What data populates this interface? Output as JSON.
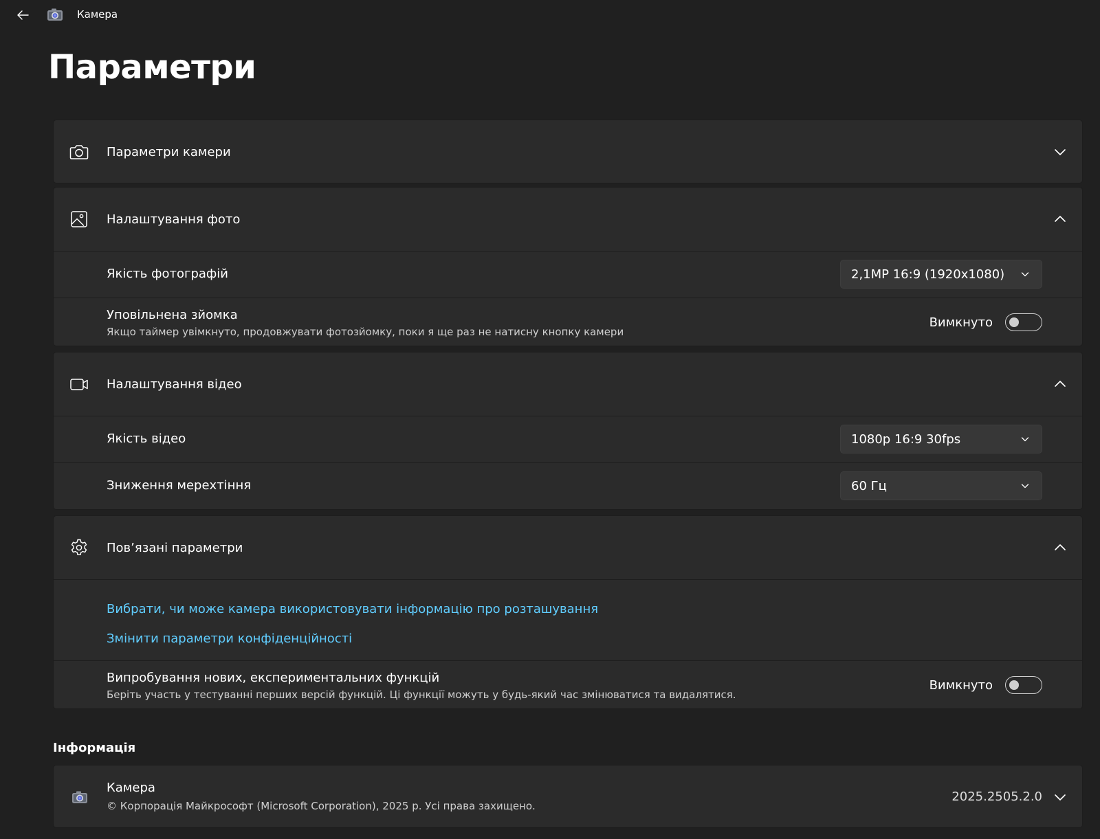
{
  "app": {
    "title": "Камера"
  },
  "page": {
    "title": "Параметри"
  },
  "sections": {
    "camera_settings": {
      "title": "Параметри камери",
      "icon": "camera-icon",
      "expanded": false
    },
    "photo_settings": {
      "title": "Налаштування фото",
      "icon": "image-icon",
      "expanded": true,
      "photo_quality": {
        "label": "Якість фотографій",
        "value": "2,1MP 16:9 (1920x1080)"
      },
      "slow_shooting": {
        "label": "Уповільнена зйомка",
        "description": "Якщо таймер увімкнуто, продовжувати фотозйомку, поки я ще раз не натисну кнопку камери",
        "state_label": "Вимкнуто",
        "on": false
      }
    },
    "video_settings": {
      "title": "Налаштування відео",
      "icon": "video-icon",
      "expanded": true,
      "video_quality": {
        "label": "Якість відео",
        "value": "1080p 16:9 30fps"
      },
      "flicker_reduction": {
        "label": "Зниження мерехтіння",
        "value": "60 Гц"
      }
    },
    "related_settings": {
      "title": "Пов’язані параметри",
      "icon": "gear-icon",
      "expanded": true,
      "links": [
        "Вибрати, чи може камера використовувати інформацію про розташування",
        "Змінити параметри конфіденційності"
      ],
      "experimental": {
        "label": "Випробування нових, експериментальних функцій",
        "description": "Беріть участь у тестуванні перших версій функцій. Ці функції можуть у будь-який час змінюватися та видалятися.",
        "state_label": "Вимкнуто",
        "on": false
      }
    }
  },
  "info": {
    "section_title": "Інформація",
    "app_name": "Камера",
    "copyright": "© Корпорація Майкрософт (Microsoft Corporation), 2025 р. Усі права захищено.",
    "version": "2025.2505.2.0"
  },
  "colors": {
    "background": "#202020",
    "card": "#2b2b2b",
    "link": "#60cdff"
  }
}
